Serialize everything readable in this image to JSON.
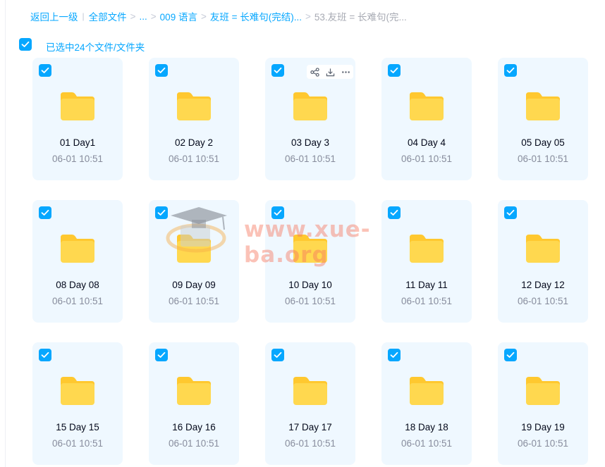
{
  "breadcrumb": {
    "back": "返回上一级",
    "root": "全部文件",
    "ellipsis": "...",
    "level1": "009 语言",
    "level2": "友班 = 长难句(完结)...",
    "current": "53.友班 = 长难句(完..."
  },
  "selection": {
    "label": "已选中24个文件/文件夹"
  },
  "files": [
    {
      "name": "01 Day1",
      "date": "06-01 10:51"
    },
    {
      "name": "02 Day 2",
      "date": "06-01 10:51"
    },
    {
      "name": "03 Day 3",
      "date": "06-01 10:51"
    },
    {
      "name": "04 Day 4",
      "date": "06-01 10:51"
    },
    {
      "name": "05 Day 05",
      "date": "06-01 10:51"
    },
    {
      "name": "08 Day 08",
      "date": "06-01 10:51"
    },
    {
      "name": "09 Day 09",
      "date": "06-01 10:51"
    },
    {
      "name": "10 Day 10",
      "date": "06-01 10:51"
    },
    {
      "name": "11 Day 11",
      "date": "06-01 10:51"
    },
    {
      "name": "12 Day 12",
      "date": "06-01 10:51"
    },
    {
      "name": "15 Day 15",
      "date": "06-01 10:51"
    },
    {
      "name": "16 Day 16",
      "date": "06-01 10:51"
    },
    {
      "name": "17 Day 17",
      "date": "06-01 10:51"
    },
    {
      "name": "18 Day 18",
      "date": "06-01 10:51"
    },
    {
      "name": "19 Day 19",
      "date": "06-01 10:51"
    }
  ],
  "hover_actions": [
    "share-icon",
    "download-icon",
    "more-icon"
  ],
  "watermark": {
    "text": "www.xue-ba.org"
  },
  "colors": {
    "accent": "#06a7ff",
    "card_bg": "#eff8ff",
    "folder": "#ffd84f",
    "folder_tab": "#ffc82f",
    "muted_text": "#878c9c"
  }
}
